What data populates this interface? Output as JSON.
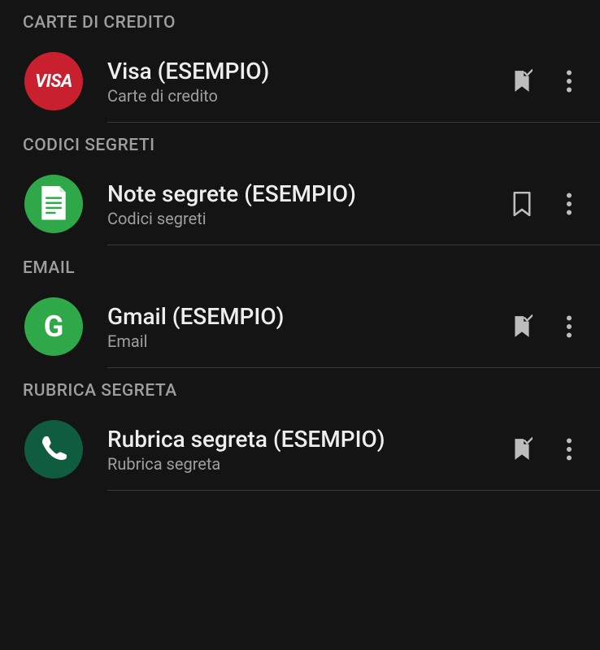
{
  "sections": [
    {
      "header": "CARTE DI CREDITO",
      "items": [
        {
          "title": "Visa (ESEMPIO)",
          "subtitle": "Carte di credito",
          "avatar_type": "visa",
          "avatar_label": "VISA",
          "avatar_bg": "#c8202f",
          "bookmark_checked": true
        }
      ]
    },
    {
      "header": "CODICI SEGRETI",
      "items": [
        {
          "title": "Note segrete (ESEMPIO)",
          "subtitle": "Codici segreti",
          "avatar_type": "notes",
          "avatar_bg": "#2fa84a",
          "bookmark_checked": false
        }
      ]
    },
    {
      "header": "EMAIL",
      "items": [
        {
          "title": "Gmail (ESEMPIO)",
          "subtitle": "Email",
          "avatar_type": "gmail",
          "avatar_label": "G",
          "avatar_bg": "#2fa84a",
          "bookmark_checked": true
        }
      ]
    },
    {
      "header": "RUBRICA SEGRETA",
      "items": [
        {
          "title": "Rubrica segreta (ESEMPIO)",
          "subtitle": "Rubrica segreta",
          "avatar_type": "phone",
          "avatar_bg": "#0f5c3e",
          "bookmark_checked": true
        }
      ]
    }
  ]
}
